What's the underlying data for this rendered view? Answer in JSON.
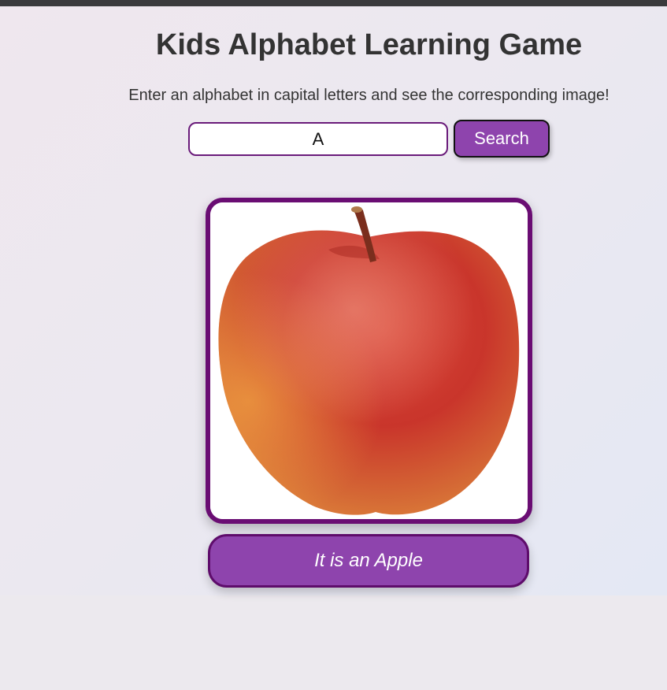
{
  "header": {
    "title": "Kids Alphabet Learning Game",
    "subtitle": "Enter an alphabet in capital letters and see the corresponding image!"
  },
  "search": {
    "value": "A",
    "button_label": "Search"
  },
  "result": {
    "image_icon": "apple-image",
    "caption": "It is an Apple"
  },
  "colors": {
    "accent": "#8e44ad",
    "border_dark": "#6a0d73",
    "title_text": "#333333"
  }
}
